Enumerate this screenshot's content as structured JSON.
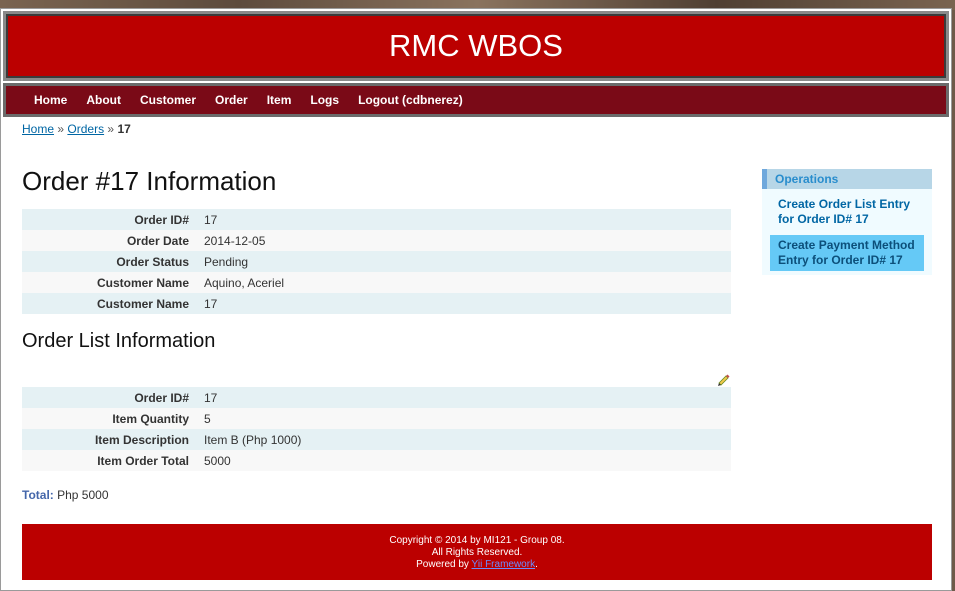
{
  "header": {
    "logo": "RMC WBOS"
  },
  "mainmenu": {
    "items": [
      "Home",
      "About",
      "Customer",
      "Order",
      "Item",
      "Logs",
      "Logout (cdbnerez)"
    ]
  },
  "breadcrumbs": {
    "home": "Home",
    "sep": "»",
    "orders": "Orders",
    "current": "17"
  },
  "page_title": "Order #17 Information",
  "order_details": [
    {
      "label": "Order ID#",
      "value": "17"
    },
    {
      "label": "Order Date",
      "value": "2014-12-05"
    },
    {
      "label": "Order Status",
      "value": "Pending"
    },
    {
      "label": "Customer Name",
      "value": "Aquino, Aceriel"
    },
    {
      "label": "Customer Name",
      "value": "17"
    }
  ],
  "order_list_title": "Order List Information",
  "order_list_details": [
    {
      "label": "Order ID#",
      "value": "17"
    },
    {
      "label": "Item Quantity",
      "value": "5"
    },
    {
      "label": "Item Description",
      "value": "Item B (Php 1000)"
    },
    {
      "label": "Item Order Total",
      "value": "5000"
    }
  ],
  "total": {
    "label": "Total:",
    "value": "Php 5000"
  },
  "operations": {
    "title": "Operations",
    "items": [
      {
        "label": "Create Order List Entry for Order ID# 17"
      },
      {
        "label": "Create Payment Method Entry for Order ID# 17"
      }
    ]
  },
  "footer": {
    "line1": "Copyright © 2014 by MI121 - Group 08.",
    "line2": "All Rights Reserved.",
    "line3_prefix": "Powered by",
    "line3_link": "Yii Framework",
    "line3_suffix": "."
  },
  "icons": {
    "edit": "pencil-icon"
  },
  "colors": {
    "header_red": "#bb0000",
    "menu_bg": "#7a0a17",
    "link_blue": "#0066a4",
    "odd_row": "#e5f1f4",
    "even_row": "#f8f8f8",
    "active_op": "#65c9f6"
  }
}
